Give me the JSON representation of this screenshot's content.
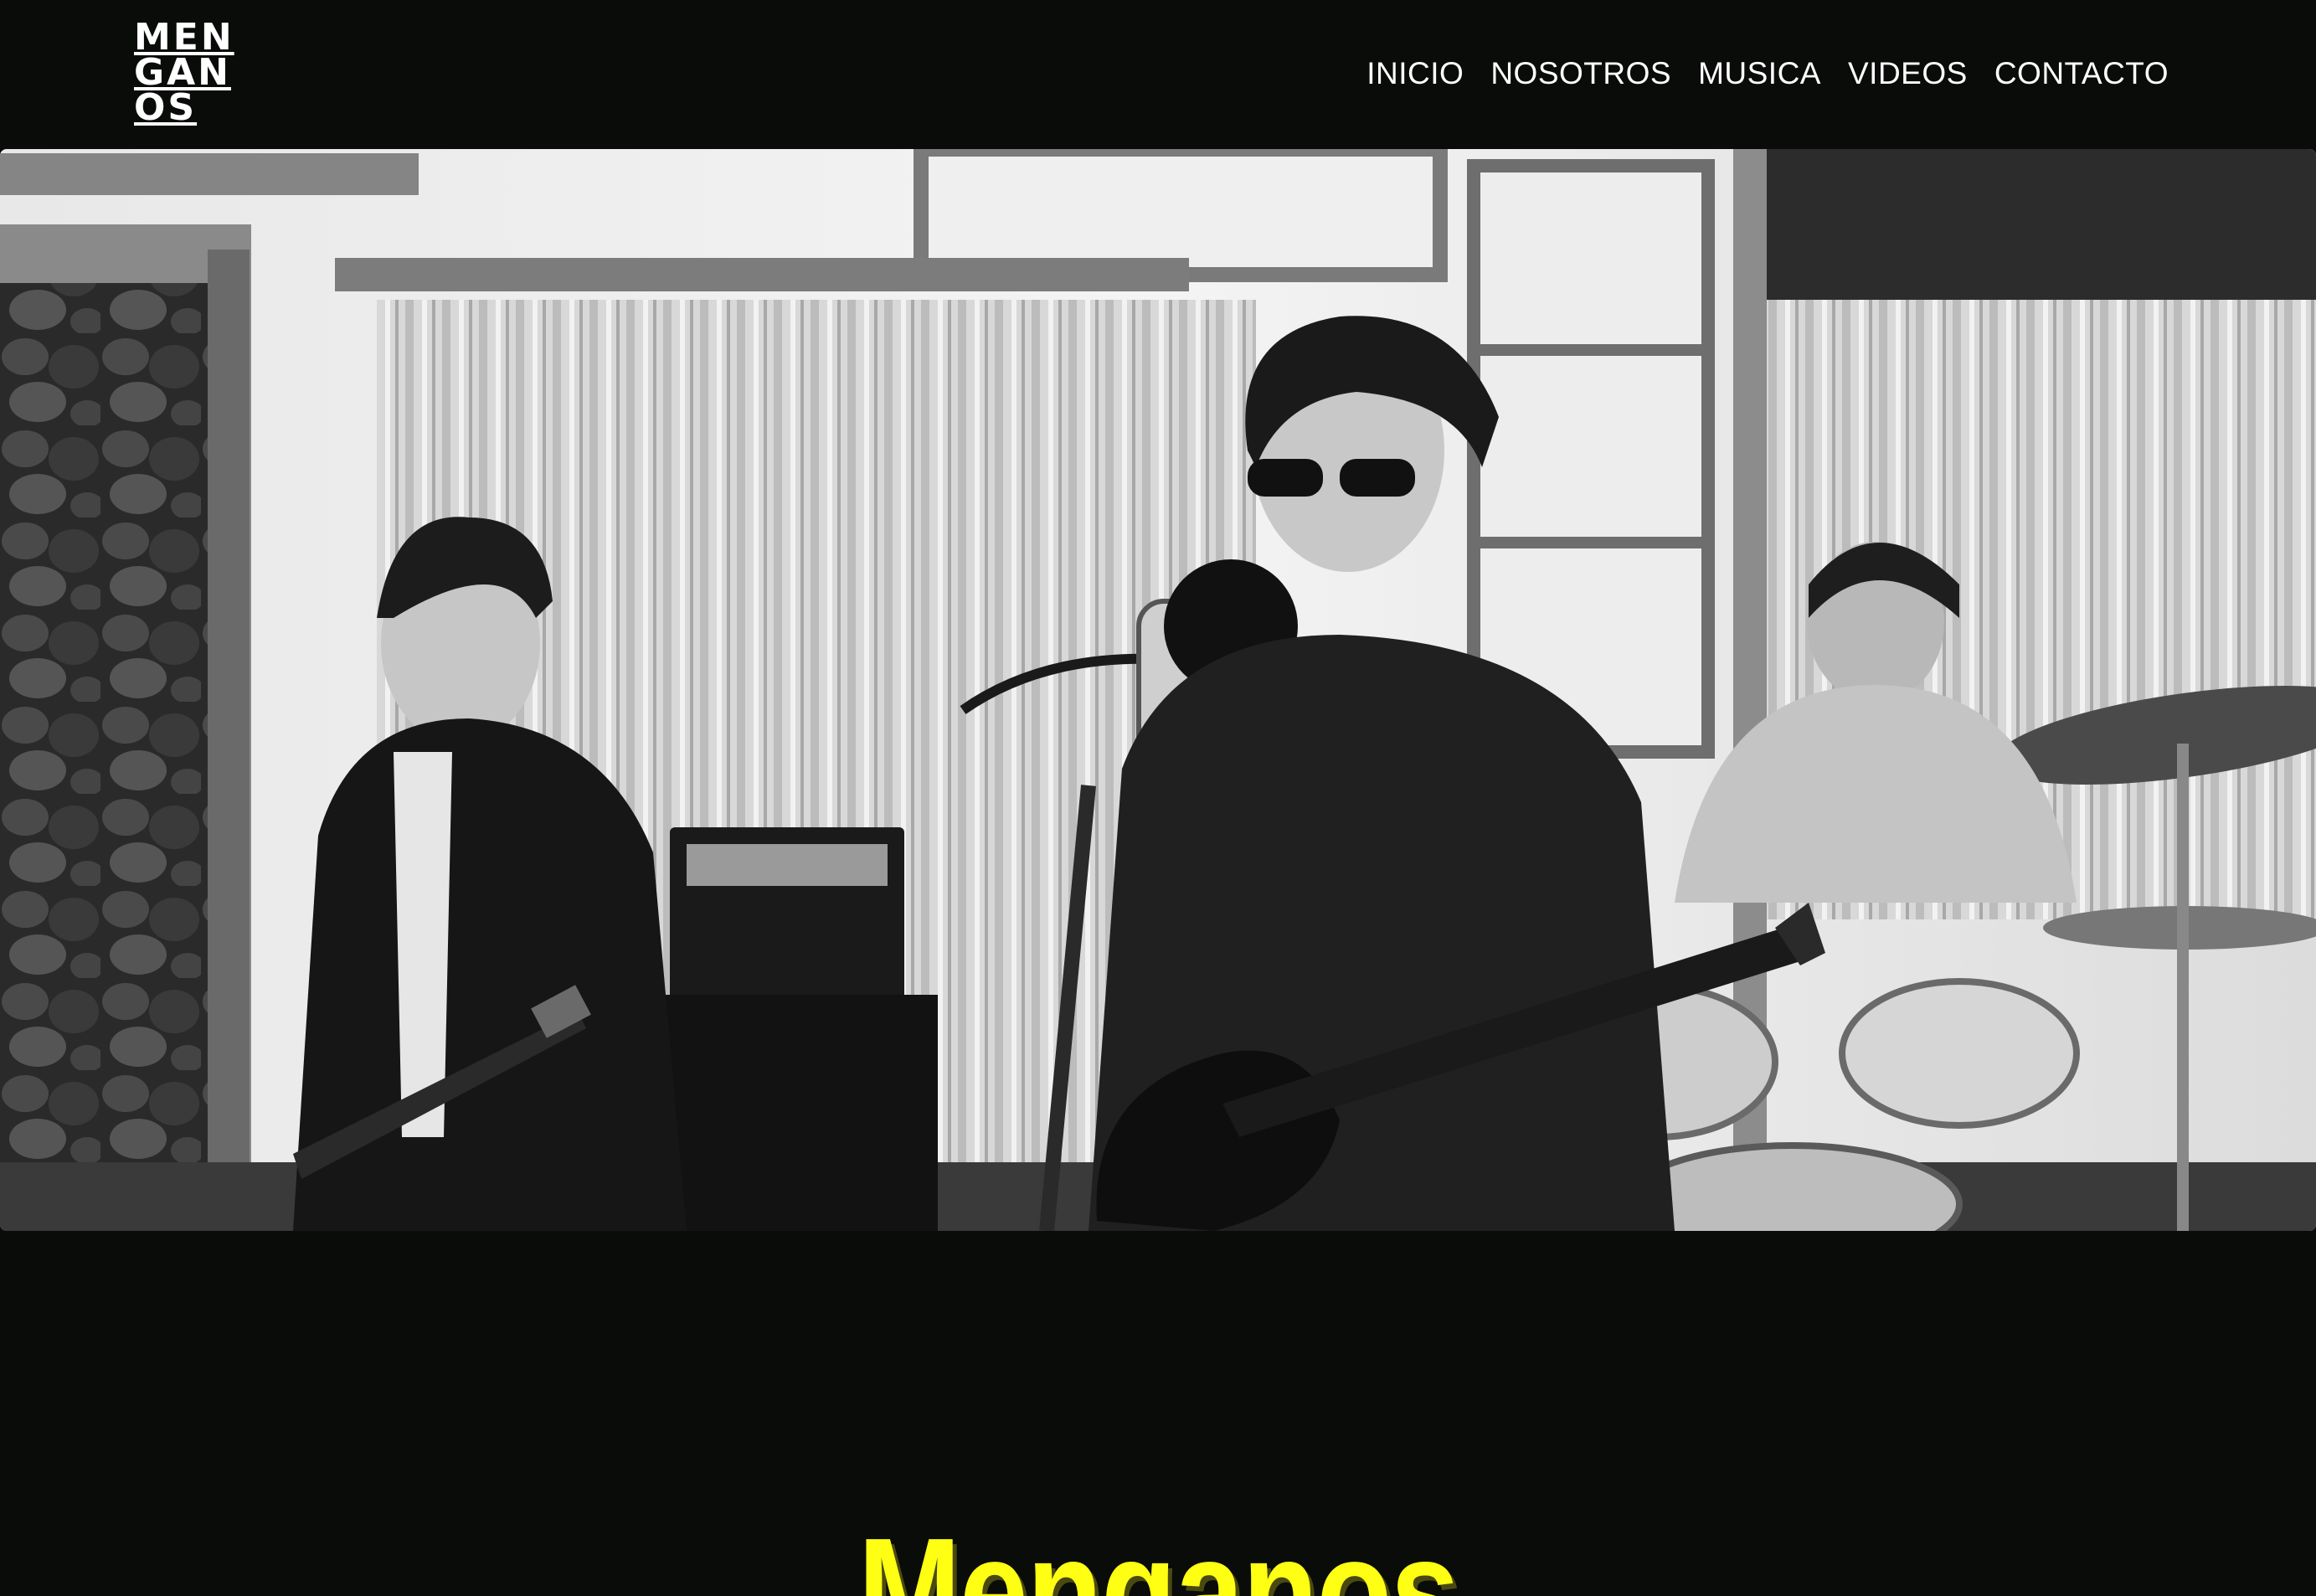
{
  "header": {
    "logo": {
      "lines": [
        "MEN",
        "GAN",
        "OS"
      ]
    },
    "nav": {
      "items": [
        "INICIO",
        "NOSOTROS",
        "MUSICA",
        "VIDEOS",
        "CONTACTO"
      ]
    }
  },
  "hero": {
    "image_icon": "band-photo"
  },
  "main": {
    "title": "Menganos"
  },
  "colors": {
    "background": "#0a0c0a",
    "nav_text": "#ffffff",
    "title": "#ffff14"
  }
}
